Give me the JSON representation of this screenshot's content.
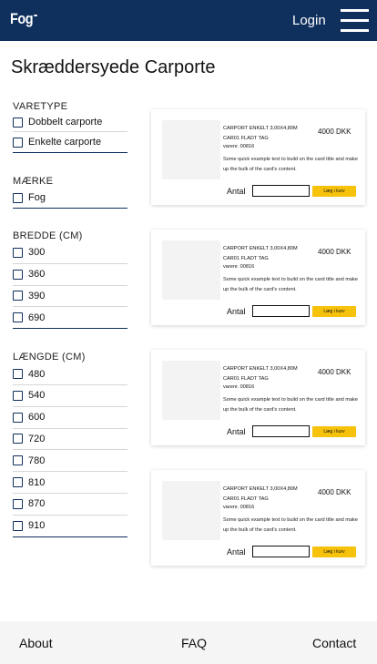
{
  "header": {
    "logo": "Fog",
    "login_label": "Login",
    "menu_icon": "hamburger-menu-icon",
    "background_color": "#0f2f5d"
  },
  "page": {
    "title": "Skræddersyede Carporte"
  },
  "filters": [
    {
      "title": "VARETYPE",
      "options": [
        "Dobbelt carporte",
        "Enkelte carporte"
      ]
    },
    {
      "title": "MÆRKE",
      "options": [
        "Fog"
      ]
    },
    {
      "title": "BREDDE (CM)",
      "options": [
        "300",
        "360",
        "390",
        "690"
      ]
    },
    {
      "title": "LÆNGDE (CM)",
      "options": [
        "480",
        "540",
        "600",
        "720",
        "780",
        "810",
        "870",
        "910"
      ]
    }
  ],
  "products": [
    {
      "title": "CARPORT ENKELT 3,00X4,80M CAR01 FLADT TAG",
      "price": "4000 DKK",
      "sku": "varenr. 00816",
      "description": "Some quick example text to build on the card title and make up the bulk of the card's content.",
      "quantity_label": "Antal",
      "quantity_value": "",
      "button_label": "Læg i kurv"
    },
    {
      "title": "CARPORT ENKELT 3,00X4,80M CAR01 FLADT TAG",
      "price": "4000 DKK",
      "sku": "varenr. 00816",
      "description": "Some quick example text to build on the card title and make up the bulk of the card's content.",
      "quantity_label": "Antal",
      "quantity_value": "",
      "button_label": "Læg i kurv"
    },
    {
      "title": "CARPORT ENKELT 3,00X4,80M CAR01 FLADT TAG",
      "price": "4000 DKK",
      "sku": "varenr. 00816",
      "description": "Some quick example text to build on the card title and make up the bulk of the card's content.",
      "quantity_label": "Antal",
      "quantity_value": "",
      "button_label": "Læg i kurv"
    },
    {
      "title": "CARPORT ENKELT 3,00X4,80M CAR01 FLADT TAG",
      "price": "4000 DKK",
      "sku": "varenr. 00816",
      "description": "Some quick example text to build on the card title and make up the bulk of the card's content.",
      "quantity_label": "Antal",
      "quantity_value": "",
      "button_label": "Læg i kurv"
    }
  ],
  "colors": {
    "accent_button": "#f6c20b",
    "brand_navy": "#0f2f5d"
  },
  "footer": {
    "about": "About",
    "faq": "FAQ",
    "contact": "Contact"
  }
}
